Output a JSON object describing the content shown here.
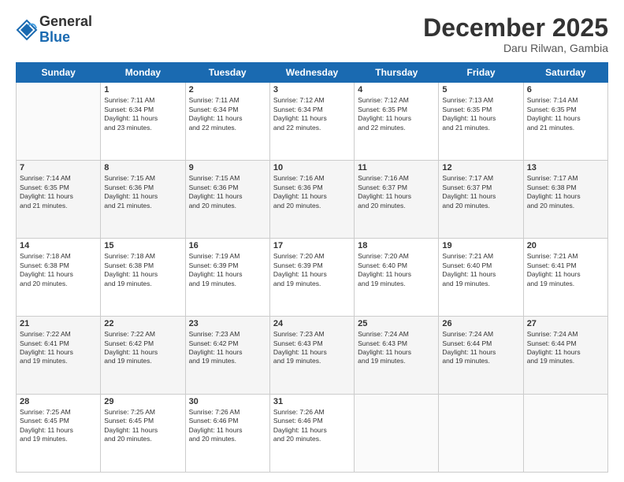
{
  "logo": {
    "general": "General",
    "blue": "Blue"
  },
  "header": {
    "month": "December 2025",
    "location": "Daru Rilwan, Gambia"
  },
  "weekdays": [
    "Sunday",
    "Monday",
    "Tuesday",
    "Wednesday",
    "Thursday",
    "Friday",
    "Saturday"
  ],
  "weeks": [
    [
      {
        "day": "",
        "info": ""
      },
      {
        "day": "1",
        "info": "Sunrise: 7:11 AM\nSunset: 6:34 PM\nDaylight: 11 hours\nand 23 minutes."
      },
      {
        "day": "2",
        "info": "Sunrise: 7:11 AM\nSunset: 6:34 PM\nDaylight: 11 hours\nand 22 minutes."
      },
      {
        "day": "3",
        "info": "Sunrise: 7:12 AM\nSunset: 6:34 PM\nDaylight: 11 hours\nand 22 minutes."
      },
      {
        "day": "4",
        "info": "Sunrise: 7:12 AM\nSunset: 6:35 PM\nDaylight: 11 hours\nand 22 minutes."
      },
      {
        "day": "5",
        "info": "Sunrise: 7:13 AM\nSunset: 6:35 PM\nDaylight: 11 hours\nand 21 minutes."
      },
      {
        "day": "6",
        "info": "Sunrise: 7:14 AM\nSunset: 6:35 PM\nDaylight: 11 hours\nand 21 minutes."
      }
    ],
    [
      {
        "day": "7",
        "info": "Sunrise: 7:14 AM\nSunset: 6:35 PM\nDaylight: 11 hours\nand 21 minutes."
      },
      {
        "day": "8",
        "info": "Sunrise: 7:15 AM\nSunset: 6:36 PM\nDaylight: 11 hours\nand 21 minutes."
      },
      {
        "day": "9",
        "info": "Sunrise: 7:15 AM\nSunset: 6:36 PM\nDaylight: 11 hours\nand 20 minutes."
      },
      {
        "day": "10",
        "info": "Sunrise: 7:16 AM\nSunset: 6:36 PM\nDaylight: 11 hours\nand 20 minutes."
      },
      {
        "day": "11",
        "info": "Sunrise: 7:16 AM\nSunset: 6:37 PM\nDaylight: 11 hours\nand 20 minutes."
      },
      {
        "day": "12",
        "info": "Sunrise: 7:17 AM\nSunset: 6:37 PM\nDaylight: 11 hours\nand 20 minutes."
      },
      {
        "day": "13",
        "info": "Sunrise: 7:17 AM\nSunset: 6:38 PM\nDaylight: 11 hours\nand 20 minutes."
      }
    ],
    [
      {
        "day": "14",
        "info": "Sunrise: 7:18 AM\nSunset: 6:38 PM\nDaylight: 11 hours\nand 20 minutes."
      },
      {
        "day": "15",
        "info": "Sunrise: 7:18 AM\nSunset: 6:38 PM\nDaylight: 11 hours\nand 19 minutes."
      },
      {
        "day": "16",
        "info": "Sunrise: 7:19 AM\nSunset: 6:39 PM\nDaylight: 11 hours\nand 19 minutes."
      },
      {
        "day": "17",
        "info": "Sunrise: 7:20 AM\nSunset: 6:39 PM\nDaylight: 11 hours\nand 19 minutes."
      },
      {
        "day": "18",
        "info": "Sunrise: 7:20 AM\nSunset: 6:40 PM\nDaylight: 11 hours\nand 19 minutes."
      },
      {
        "day": "19",
        "info": "Sunrise: 7:21 AM\nSunset: 6:40 PM\nDaylight: 11 hours\nand 19 minutes."
      },
      {
        "day": "20",
        "info": "Sunrise: 7:21 AM\nSunset: 6:41 PM\nDaylight: 11 hours\nand 19 minutes."
      }
    ],
    [
      {
        "day": "21",
        "info": "Sunrise: 7:22 AM\nSunset: 6:41 PM\nDaylight: 11 hours\nand 19 minutes."
      },
      {
        "day": "22",
        "info": "Sunrise: 7:22 AM\nSunset: 6:42 PM\nDaylight: 11 hours\nand 19 minutes."
      },
      {
        "day": "23",
        "info": "Sunrise: 7:23 AM\nSunset: 6:42 PM\nDaylight: 11 hours\nand 19 minutes."
      },
      {
        "day": "24",
        "info": "Sunrise: 7:23 AM\nSunset: 6:43 PM\nDaylight: 11 hours\nand 19 minutes."
      },
      {
        "day": "25",
        "info": "Sunrise: 7:24 AM\nSunset: 6:43 PM\nDaylight: 11 hours\nand 19 minutes."
      },
      {
        "day": "26",
        "info": "Sunrise: 7:24 AM\nSunset: 6:44 PM\nDaylight: 11 hours\nand 19 minutes."
      },
      {
        "day": "27",
        "info": "Sunrise: 7:24 AM\nSunset: 6:44 PM\nDaylight: 11 hours\nand 19 minutes."
      }
    ],
    [
      {
        "day": "28",
        "info": "Sunrise: 7:25 AM\nSunset: 6:45 PM\nDaylight: 11 hours\nand 19 minutes."
      },
      {
        "day": "29",
        "info": "Sunrise: 7:25 AM\nSunset: 6:45 PM\nDaylight: 11 hours\nand 20 minutes."
      },
      {
        "day": "30",
        "info": "Sunrise: 7:26 AM\nSunset: 6:46 PM\nDaylight: 11 hours\nand 20 minutes."
      },
      {
        "day": "31",
        "info": "Sunrise: 7:26 AM\nSunset: 6:46 PM\nDaylight: 11 hours\nand 20 minutes."
      },
      {
        "day": "",
        "info": ""
      },
      {
        "day": "",
        "info": ""
      },
      {
        "day": "",
        "info": ""
      }
    ]
  ]
}
